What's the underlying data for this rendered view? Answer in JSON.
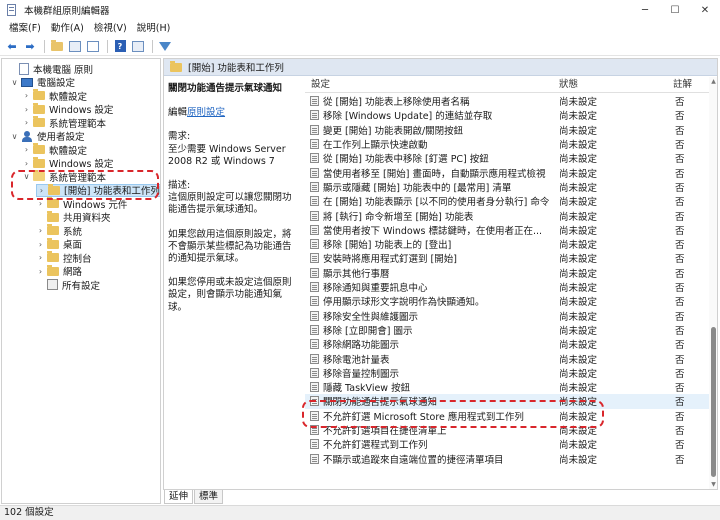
{
  "window": {
    "title": "本機群組原則編輯器",
    "minimize": "─",
    "maximize": "☐",
    "close": "✕"
  },
  "menu": [
    "檔案(F)",
    "動作(A)",
    "檢視(V)",
    "說明(H)"
  ],
  "tree": [
    {
      "label": "本機電腦 原則",
      "level": 0,
      "icon": "document",
      "expander": ""
    },
    {
      "label": "電腦設定",
      "level": 1,
      "icon": "computer",
      "expander": "∨"
    },
    {
      "label": "軟體設定",
      "level": 2,
      "icon": "folder",
      "expander": "›"
    },
    {
      "label": "Windows 設定",
      "level": 2,
      "icon": "folder",
      "expander": "›"
    },
    {
      "label": "系統管理範本",
      "level": 2,
      "icon": "folder",
      "expander": "›"
    },
    {
      "label": "使用者設定",
      "level": 1,
      "icon": "user",
      "expander": "∨"
    },
    {
      "label": "軟體設定",
      "level": 2,
      "icon": "folder",
      "expander": "›"
    },
    {
      "label": "Windows 設定",
      "level": 2,
      "icon": "folder",
      "expander": "›"
    },
    {
      "label": "系統管理範本",
      "level": 2,
      "icon": "folder-open",
      "expander": "∨"
    },
    {
      "label": "[開始] 功能表和工作列",
      "level": 3,
      "icon": "folder",
      "expander": "›",
      "selected": true
    },
    {
      "label": "Windows 元件",
      "level": 3,
      "icon": "folder",
      "expander": "›"
    },
    {
      "label": "共用資料夾",
      "level": 3,
      "icon": "folder",
      "expander": ""
    },
    {
      "label": "系統",
      "level": 3,
      "icon": "folder",
      "expander": "›"
    },
    {
      "label": "桌面",
      "level": 3,
      "icon": "folder",
      "expander": "›"
    },
    {
      "label": "控制台",
      "level": 3,
      "icon": "folder",
      "expander": "›"
    },
    {
      "label": "網路",
      "level": 3,
      "icon": "folder",
      "expander": "›"
    },
    {
      "label": "所有設定",
      "level": 3,
      "icon": "settings",
      "expander": ""
    }
  ],
  "right": {
    "header": "[開始] 功能表和工作列",
    "desc": {
      "title": "關閉功能通告提示氣球通知",
      "edit_prefix": "編輯",
      "edit_link": "原則設定",
      "req_label": "需求:",
      "req_text": "至少需要 Windows Server 2008 R2 或 Windows 7",
      "desc_label": "描述:",
      "desc_text": "這個原則設定可以讓您關閉功能通告提示氣球通知。",
      "p1": "如果您啟用這個原則設定，將不會顯示某些標記為功能通告的通知提示氣球。",
      "p2": "如果您停用或未設定這個原則設定，則會顯示功能通知氣球。"
    },
    "columns": {
      "name": "設定",
      "state": "狀態",
      "note": "註解"
    },
    "rows": [
      {
        "name": "從 [開始] 功能表上移除使用者名稱",
        "state": "尚未設定",
        "note": "否"
      },
      {
        "name": "移除 [Windows Update] 的連結並存取",
        "state": "尚未設定",
        "note": "否"
      },
      {
        "name": "變更 [開始] 功能表開啟/關閉按鈕",
        "state": "尚未設定",
        "note": "否"
      },
      {
        "name": "在工作列上顯示快速啟動",
        "state": "尚未設定",
        "note": "否"
      },
      {
        "name": "從 [開始] 功能表中移除 [釘選 PC] 按鈕",
        "state": "尚未設定",
        "note": "否"
      },
      {
        "name": "當使用者移至 [開始] 畫面時，自動顯示應用程式檢視",
        "state": "尚未設定",
        "note": "否"
      },
      {
        "name": "顯示或隱藏 [開始] 功能表中的 [最常用] 清單",
        "state": "尚未設定",
        "note": "否"
      },
      {
        "name": "在 [開始] 功能表顯示 [以不同的使用者身分執行] 命令",
        "state": "尚未設定",
        "note": "否"
      },
      {
        "name": "將 [執行] 命令新增至 [開始] 功能表",
        "state": "尚未設定",
        "note": "否"
      },
      {
        "name": "當使用者按下 Windows 標誌鍵時，在使用者正在...",
        "state": "尚未設定",
        "note": "否"
      },
      {
        "name": "移除 [開始] 功能表上的 [登出]",
        "state": "尚未設定",
        "note": "否"
      },
      {
        "name": "安裝時將應用程式釘選到 [開始]",
        "state": "尚未設定",
        "note": "否"
      },
      {
        "name": "顯示其他行事曆",
        "state": "尚未設定",
        "note": "否"
      },
      {
        "name": "移除通知與重要訊息中心",
        "state": "尚未設定",
        "note": "否"
      },
      {
        "name": "停用顯示球形文字說明作為快顯通知。",
        "state": "尚未設定",
        "note": "否"
      },
      {
        "name": "移除安全性與維護圖示",
        "state": "尚未設定",
        "note": "否"
      },
      {
        "name": "移除 [立即開會] 圖示",
        "state": "尚未設定",
        "note": "否"
      },
      {
        "name": "移除網路功能圖示",
        "state": "尚未設定",
        "note": "否"
      },
      {
        "name": "移除電池計量表",
        "state": "尚未設定",
        "note": "否"
      },
      {
        "name": "移除音量控制圖示",
        "state": "尚未設定",
        "note": "否"
      },
      {
        "name": "隱藏 TaskView 按鈕",
        "state": "尚未設定",
        "note": "否"
      },
      {
        "name": "關閉功能通告提示氣球通知",
        "state": "尚未設定",
        "note": "否",
        "highlight": true
      },
      {
        "name": "不允許釘選 Microsoft Store 應用程式到工作列",
        "state": "尚未設定",
        "note": "否"
      },
      {
        "name": "不允許釘選項目在捷徑清單上",
        "state": "尚未設定",
        "note": "否"
      },
      {
        "name": "不允許釘選程式到工作列",
        "state": "尚未設定",
        "note": "否"
      },
      {
        "name": "不顯示或追蹤來自遠端位置的捷徑清單項目",
        "state": "尚未設定",
        "note": "否"
      }
    ]
  },
  "tabs": [
    "延伸",
    "標準"
  ],
  "status": "102 個設定"
}
